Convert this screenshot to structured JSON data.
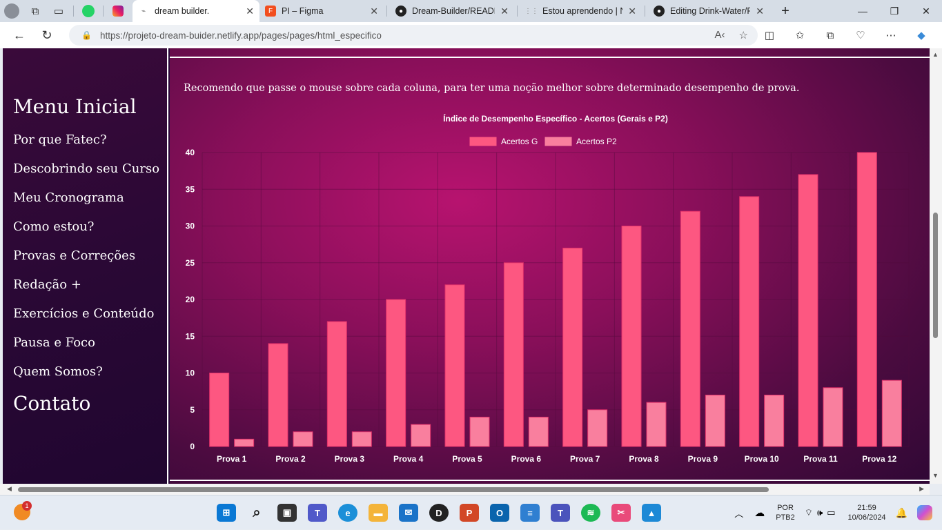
{
  "tabs": [
    {
      "title": "dream builder.",
      "active": true
    },
    {
      "title": "PI – Figma"
    },
    {
      "title": "Dream-Builder/READM"
    },
    {
      "title": "Estou aprendendo | Ne"
    },
    {
      "title": "Editing Drink-Water/R"
    }
  ],
  "url": "https://projeto-dream-buider.netlify.app/pages/pages/html_especifico",
  "sidebar": {
    "items": [
      {
        "label": "Menu Inicial",
        "big": true
      },
      {
        "label": "Por que Fatec?"
      },
      {
        "label": "Descobrindo seu Curso"
      },
      {
        "label": "Meu Cronograma"
      },
      {
        "label": "Como estou?"
      },
      {
        "label": "Provas e Correções"
      },
      {
        "label": "Redação +"
      },
      {
        "label": "Exercícios e Conteúdo"
      },
      {
        "label": "Pausa e Foco"
      },
      {
        "label": "Quem Somos?"
      },
      {
        "label": "Contato",
        "big": true
      }
    ]
  },
  "main": {
    "recommendation": "Recomendo que passe o mouse sobre cada coluna, para ter uma noção melhor sobre determinado desempenho de prova."
  },
  "chart_data": {
    "type": "bar",
    "title": "Índice de Desempenho Específico - Acertos (Gerais e P2)",
    "categories": [
      "Prova 1",
      "Prova 2",
      "Prova 3",
      "Prova 4",
      "Prova 5",
      "Prova 6",
      "Prova 7",
      "Prova 8",
      "Prova 9",
      "Prova 10",
      "Prova 11",
      "Prova 12"
    ],
    "series": [
      {
        "name": "Acertos G",
        "values": [
          10,
          14,
          17,
          20,
          22,
          25,
          27,
          30,
          32,
          34,
          37,
          40
        ],
        "color": "#fd5781"
      },
      {
        "name": "Acertos P2",
        "values": [
          1,
          2,
          2,
          3,
          4,
          4,
          5,
          6,
          7,
          7,
          8,
          9
        ],
        "color": "#f97f9e"
      }
    ],
    "ylim": [
      0,
      40
    ],
    "yticks": [
      "0",
      "5",
      "10",
      "15",
      "20",
      "25",
      "30",
      "35",
      "40"
    ],
    "legend": "top",
    "grid": true
  },
  "taskbar": {
    "lang1": "POR",
    "lang2": "PTB2",
    "time": "21:59",
    "date": "10/06/2024",
    "badge": "1"
  }
}
